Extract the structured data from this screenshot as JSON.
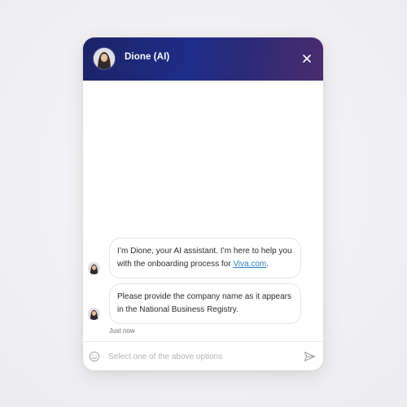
{
  "header": {
    "title": "Dione (AI)",
    "background_start": "#1b2466",
    "background_end": "#4a2c6e",
    "close_icon": "close-icon"
  },
  "messages": [
    {
      "text_before_link": "I’m Dione, your AI assistant. I’m here to help you with the onboarding process for ",
      "link_text": "Viva.com",
      "text_after_link": "."
    },
    {
      "text": "Please provide the company name as it appears in the National Business Registry."
    }
  ],
  "timestamp": "Just now",
  "composer": {
    "placeholder": "Select one of the above options",
    "emoji_icon": "smiley-icon",
    "send_icon": "send-icon"
  },
  "colors": {
    "link": "#2a78c6",
    "text": "#2c2c33",
    "placeholder": "#b4b4bb"
  }
}
